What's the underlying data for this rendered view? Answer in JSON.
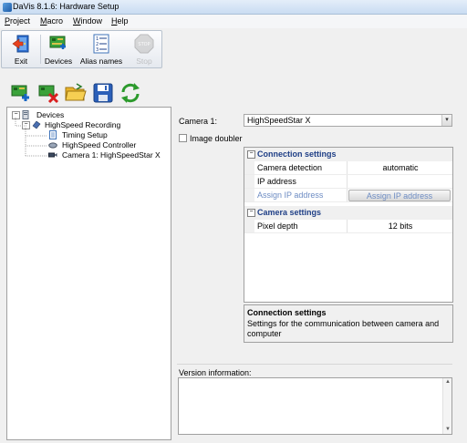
{
  "window": {
    "title": "DaVis 8.1.6: Hardware Setup"
  },
  "menu": [
    "Project",
    "Macro",
    "Window",
    "Help"
  ],
  "toolbar": {
    "exit": "Exit",
    "devices": "Devices",
    "alias_names": "Alias names",
    "stop": "Stop"
  },
  "tree": {
    "root": "Devices",
    "recording": "HighSpeed Recording",
    "timing": "Timing Setup",
    "controller": "HighSpeed Controller",
    "camera": "Camera 1: HighSpeedStar X"
  },
  "camera": {
    "label": "Camera 1:",
    "selected": "HighSpeedStar X",
    "image_doubler_label": "Image doubler",
    "image_doubler_checked": false
  },
  "properties": {
    "connection_category": "Connection settings",
    "camera_detection_name": "Camera detection",
    "camera_detection_value": "automatic",
    "ip_address_name": "IP address",
    "ip_address_value": "",
    "assign_ip_name": "Assign IP address",
    "assign_ip_button": "Assign IP address",
    "camera_category": "Camera settings",
    "pixel_depth_name": "Pixel depth",
    "pixel_depth_value": "12 bits"
  },
  "help": {
    "title": "Connection settings",
    "text": "Settings for the communication between camera and computer"
  },
  "version": {
    "label": "Version information:",
    "text": ""
  },
  "colors": {
    "category_text": "#1f3f86",
    "disabled_link": "#6d8cc3",
    "titlebar": "#c9dcf2"
  }
}
